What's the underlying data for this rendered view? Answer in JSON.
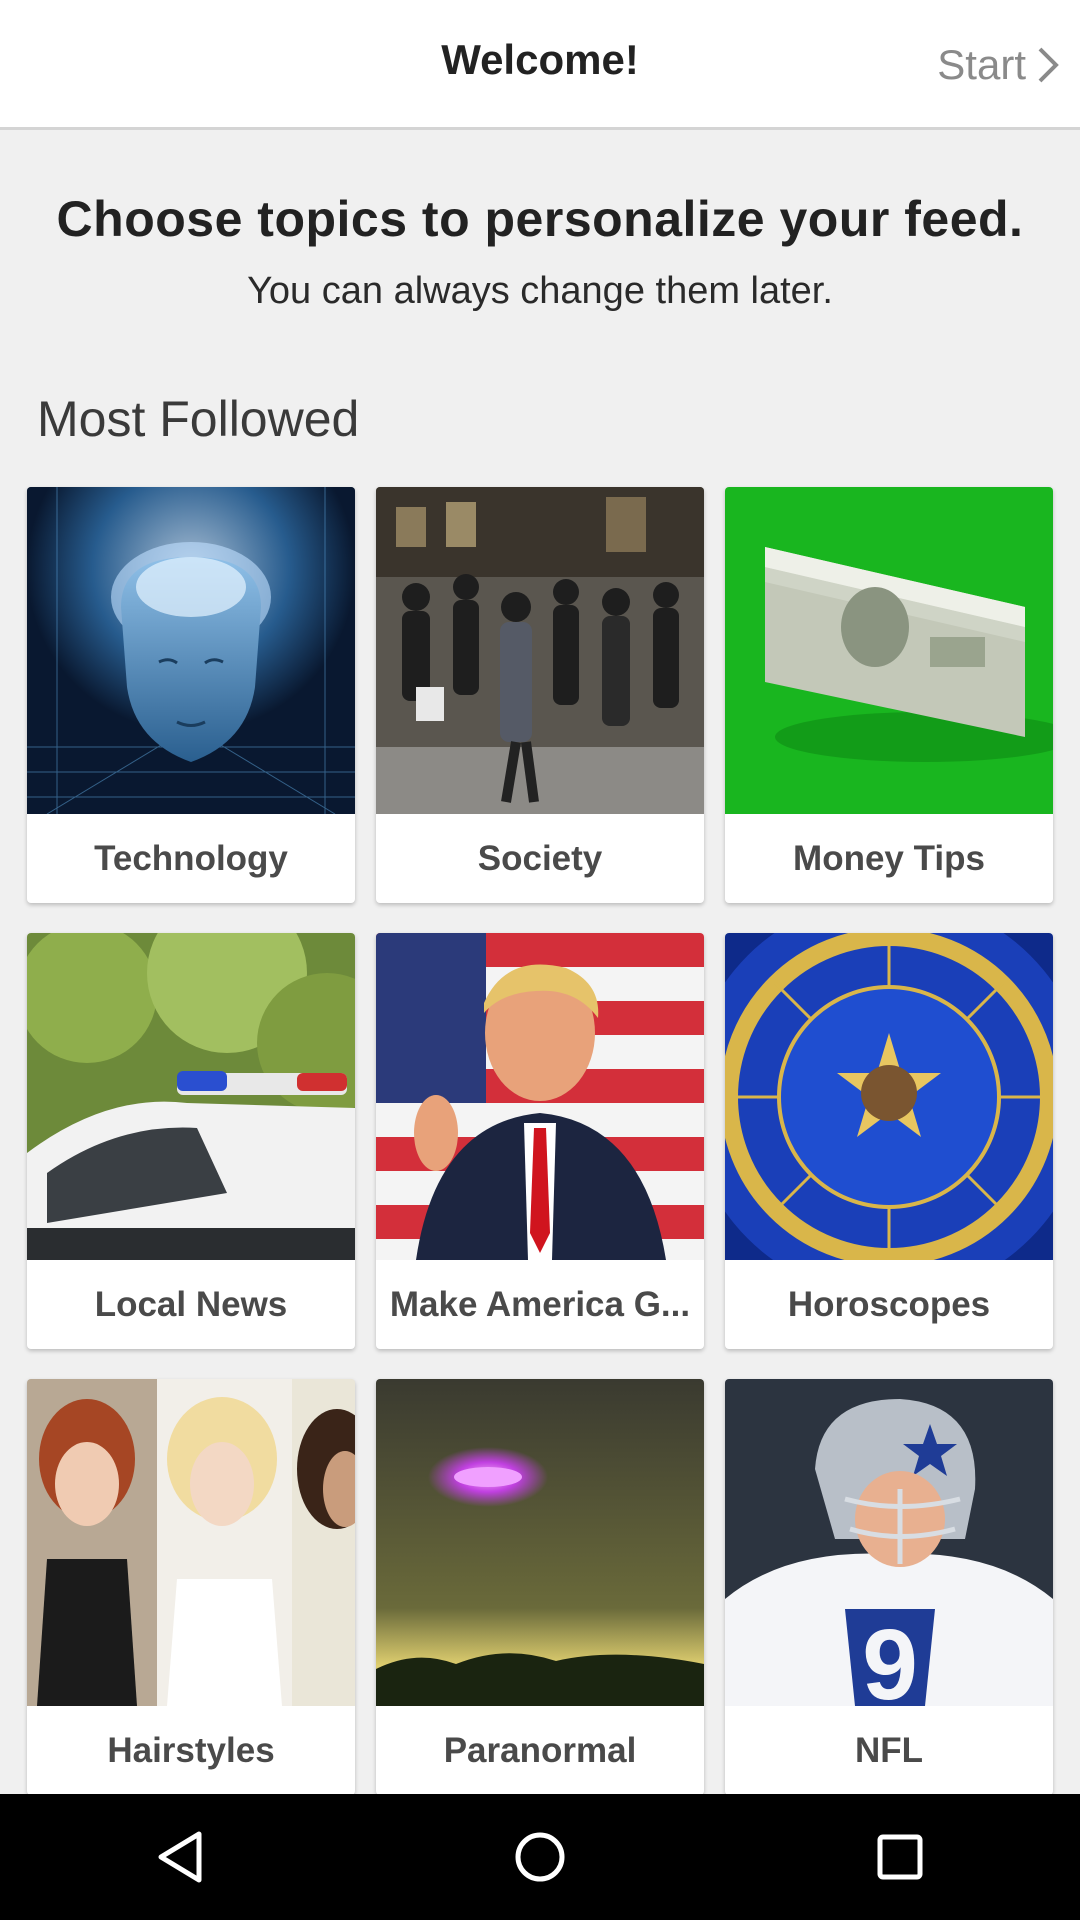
{
  "header": {
    "title": "Welcome!",
    "start_label": "Start"
  },
  "intro": {
    "headline": "Choose topics to personalize your feed.",
    "subline": "You can always change them later."
  },
  "section": {
    "title": "Most Followed"
  },
  "topics": [
    {
      "label": "Technology"
    },
    {
      "label": "Society"
    },
    {
      "label": "Money Tips"
    },
    {
      "label": "Local News"
    },
    {
      "label": "Make America G..."
    },
    {
      "label": "Horoscopes"
    },
    {
      "label": "Hairstyles"
    },
    {
      "label": "Paranormal"
    },
    {
      "label": "NFL"
    }
  ],
  "navbar": {
    "icons": [
      "back-icon",
      "home-icon",
      "recents-icon"
    ]
  }
}
